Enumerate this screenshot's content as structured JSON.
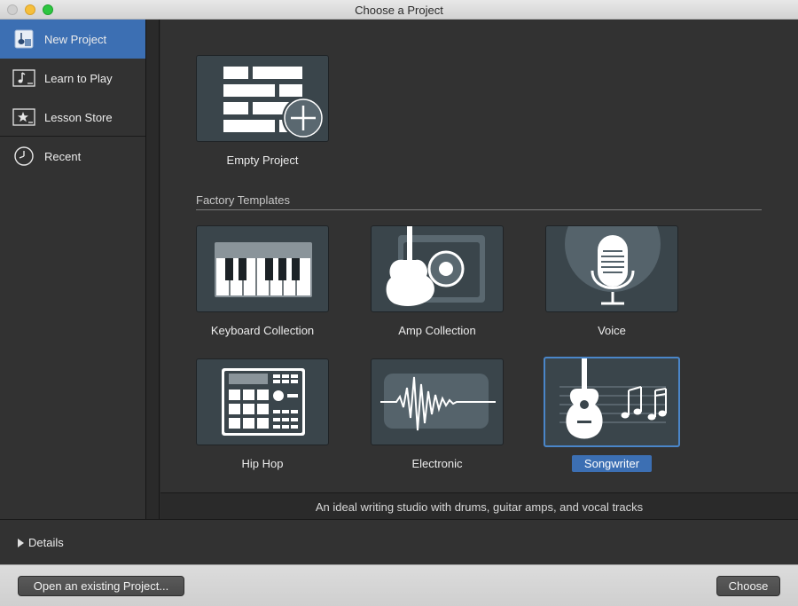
{
  "window": {
    "title": "Choose a Project"
  },
  "sidebar": {
    "items": [
      {
        "label": "New Project",
        "icon": "new-project-icon",
        "active": true
      },
      {
        "label": "Learn to Play",
        "icon": "music-note-icon"
      },
      {
        "label": "Lesson Store",
        "icon": "star-icon"
      },
      {
        "label": "Recent",
        "icon": "clock-icon"
      }
    ]
  },
  "main": {
    "empty_project": {
      "label": "Empty Project",
      "icon": "empty-project-icon"
    },
    "section_title": "Factory Templates",
    "templates": [
      {
        "label": "Keyboard Collection",
        "icon": "piano-keyboard-icon"
      },
      {
        "label": "Amp Collection",
        "icon": "guitar-amp-icon"
      },
      {
        "label": "Voice",
        "icon": "microphone-icon"
      },
      {
        "label": "Hip Hop",
        "icon": "drum-machine-icon"
      },
      {
        "label": "Electronic",
        "icon": "waveform-icon"
      },
      {
        "label": "Songwriter",
        "icon": "acoustic-guitar-notes-icon",
        "selected": true
      }
    ],
    "description": "An ideal writing studio with drums, guitar amps, and vocal tracks"
  },
  "details": {
    "label": "Details"
  },
  "footer": {
    "open_label": "Open an existing Project...",
    "choose_label": "Choose"
  },
  "colors": {
    "accent": "#3c6fb3",
    "tile": "#3a454b",
    "background": "#323232"
  }
}
